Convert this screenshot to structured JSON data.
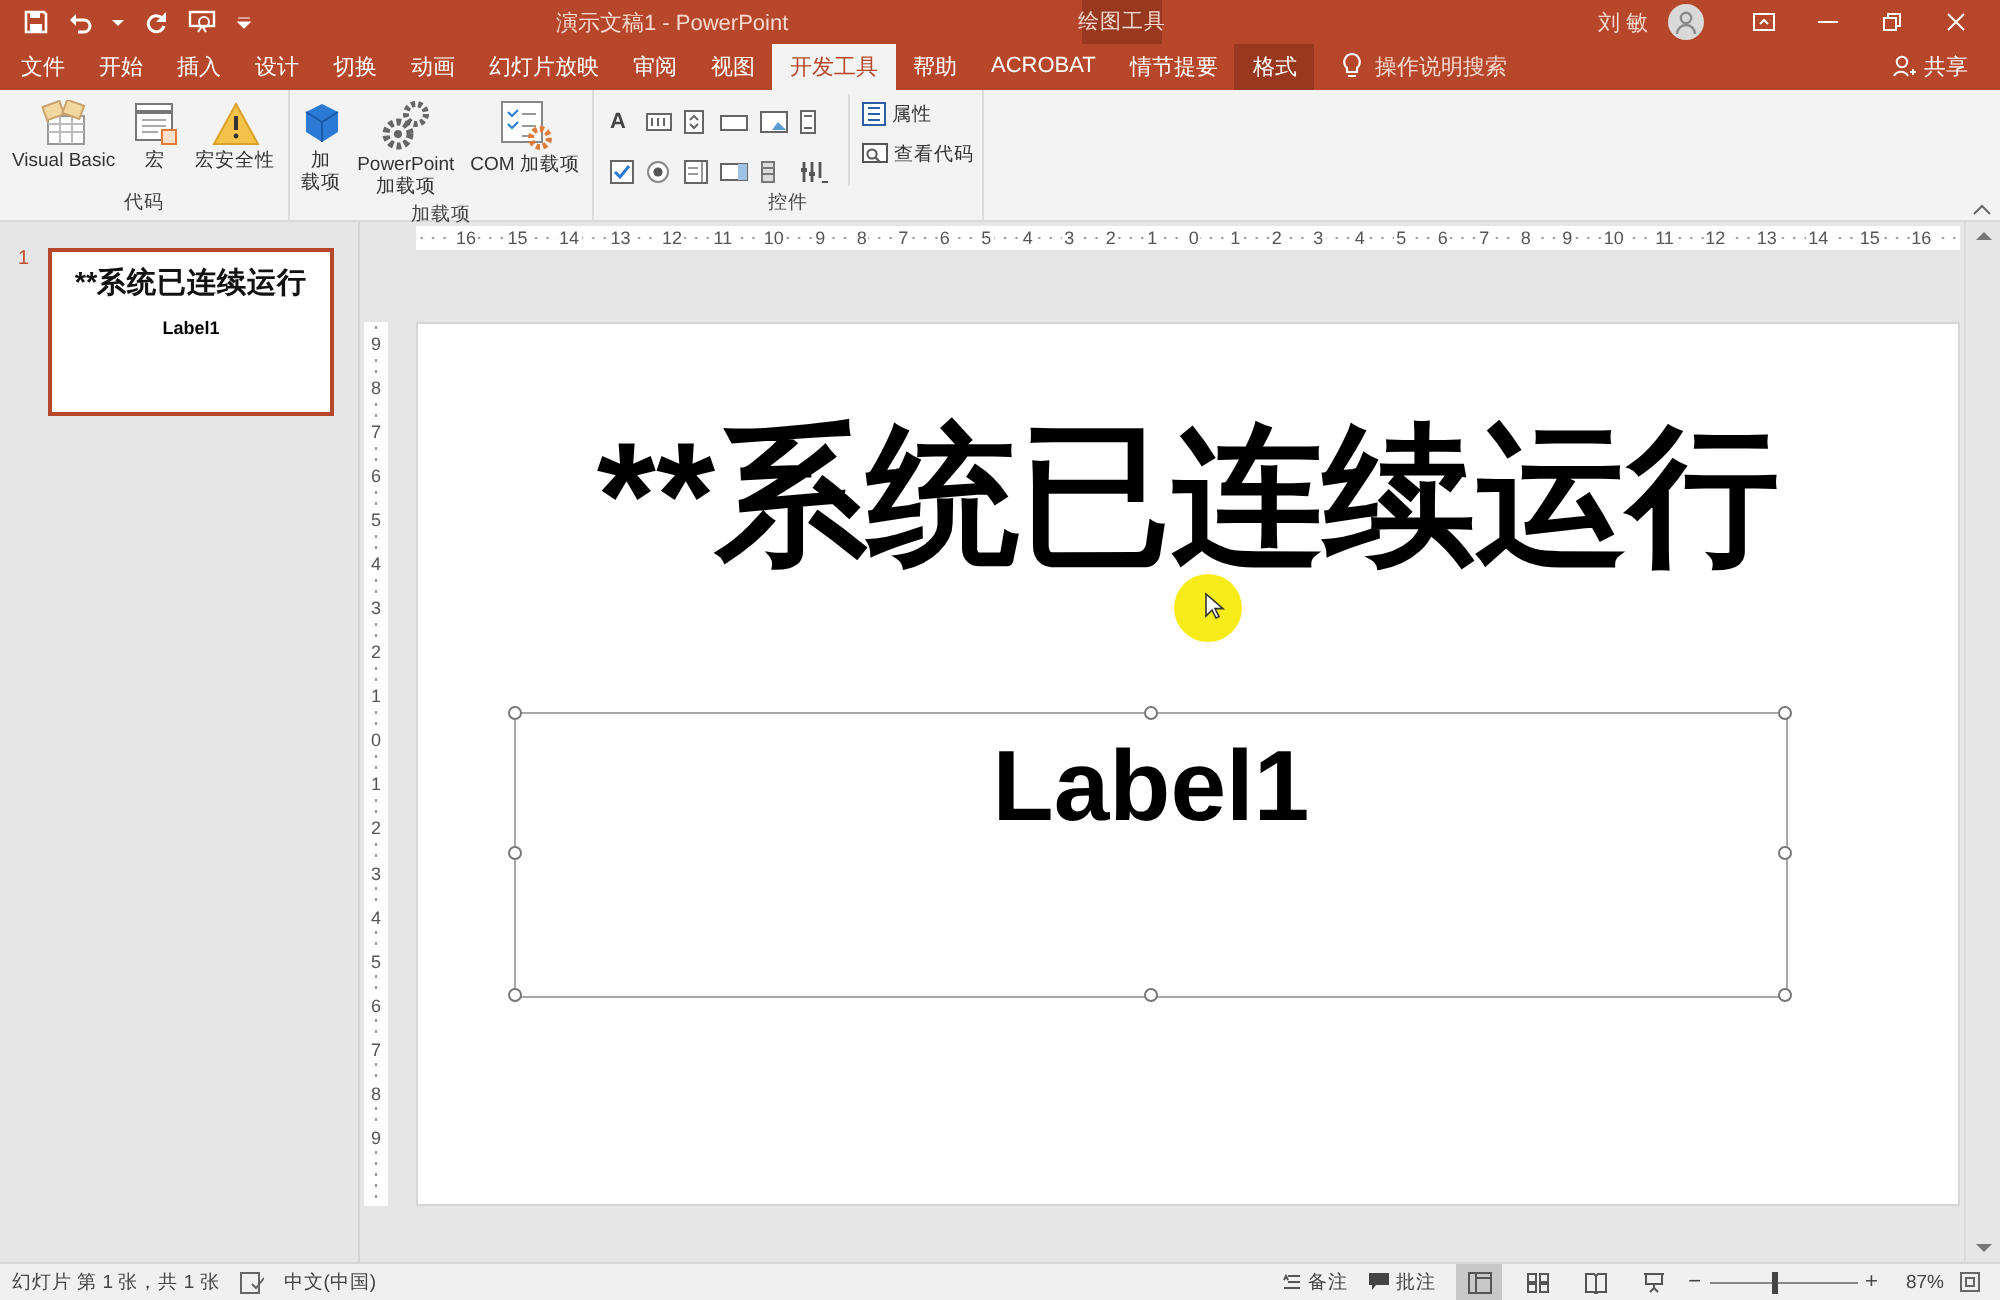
{
  "window": {
    "title": "演示文稿1 - PowerPoint",
    "context_header": "绘图工具",
    "user": "刘 敏"
  },
  "quick_access": [
    {
      "kind": "save"
    },
    {
      "kind": "undo"
    },
    {
      "kind": "dropdown"
    },
    {
      "kind": "redo"
    },
    {
      "kind": "start"
    },
    {
      "kind": "customize"
    }
  ],
  "tabs": [
    {
      "label": "文件",
      "selected": false,
      "kind": "normal"
    },
    {
      "label": "开始",
      "selected": false,
      "kind": "normal"
    },
    {
      "label": "插入",
      "selected": false,
      "kind": "normal"
    },
    {
      "label": "设计",
      "selected": false,
      "kind": "normal"
    },
    {
      "label": "切换",
      "selected": false,
      "kind": "normal"
    },
    {
      "label": "动画",
      "selected": false,
      "kind": "normal"
    },
    {
      "label": "幻灯片放映",
      "selected": false,
      "kind": "normal"
    },
    {
      "label": "审阅",
      "selected": false,
      "kind": "normal"
    },
    {
      "label": "视图",
      "selected": false,
      "kind": "normal"
    },
    {
      "label": "开发工具",
      "selected": true,
      "kind": "normal"
    },
    {
      "label": "帮助",
      "selected": false,
      "kind": "normal"
    },
    {
      "label": "ACROBAT",
      "selected": false,
      "kind": "normal"
    },
    {
      "label": "情节提要",
      "selected": false,
      "kind": "normal"
    },
    {
      "label": "格式",
      "selected": false,
      "kind": "contextual"
    }
  ],
  "tell_me": "操作说明搜索",
  "share": "共享",
  "ribbon": {
    "groups": [
      {
        "label": "代码",
        "buttons": [
          {
            "kind": "vb",
            "lines": [
              "Visual Basic"
            ]
          },
          {
            "kind": "macro",
            "lines": [
              "宏"
            ]
          },
          {
            "kind": "security",
            "lines": [
              "宏安全性"
            ]
          }
        ]
      },
      {
        "label": "加载项",
        "buttons": [
          {
            "kind": "store",
            "lines": [
              "加",
              "载项"
            ]
          },
          {
            "kind": "gears",
            "lines": [
              "PowerPoint",
              "加载项"
            ]
          },
          {
            "kind": "com",
            "lines": [
              "COM 加载项"
            ]
          }
        ]
      },
      {
        "label": "控件",
        "tools": [
          {
            "kind": "label",
            "glyph": "A"
          },
          {
            "kind": "textbox"
          },
          {
            "kind": "spin"
          },
          {
            "kind": "command"
          },
          {
            "kind": "image"
          },
          {
            "kind": "scroll"
          },
          {
            "kind": "checkbox"
          },
          {
            "kind": "radio"
          },
          {
            "kind": "list"
          },
          {
            "kind": "combo"
          },
          {
            "kind": "toggle"
          },
          {
            "kind": "more"
          }
        ],
        "small_buttons": [
          {
            "kind": "properties",
            "label": "属性"
          },
          {
            "kind": "code",
            "label": "查看代码"
          }
        ]
      }
    ]
  },
  "thumbnails": [
    {
      "number": "1",
      "title": "**系统已连续运行",
      "body": "Label1",
      "selected": true
    }
  ],
  "rulers": {
    "horizontal": [
      "16",
      "15",
      "14",
      "13",
      "12",
      "11",
      "10",
      "9",
      "8",
      "7",
      "6",
      "5",
      "4",
      "3",
      "2",
      "1",
      "0",
      "1",
      "2",
      "3",
      "4",
      "5",
      "6",
      "7",
      "8",
      "9",
      "10",
      "11",
      "12",
      "13",
      "14",
      "15",
      "16"
    ],
    "vertical": [
      "9",
      "8",
      "7",
      "6",
      "5",
      "4",
      "3",
      "2",
      "1",
      "0",
      "1",
      "2",
      "3",
      "4",
      "5",
      "6",
      "7",
      "8",
      "9"
    ]
  },
  "slide": {
    "title": "**系统已连续运行",
    "label": {
      "text": "Label1",
      "selected": true
    }
  },
  "status_bar": {
    "slide_info": "幻灯片 第 1 张，共 1 张",
    "language": "中文(中国)",
    "notes": "备注",
    "comments": "批注",
    "views": [
      {
        "kind": "normal",
        "selected": true
      },
      {
        "kind": "sorter",
        "selected": false
      },
      {
        "kind": "reading",
        "selected": false
      },
      {
        "kind": "show",
        "selected": false
      }
    ],
    "zoom_minus": "−",
    "zoom_plus": "+",
    "zoom": {
      "level": 0.43
    },
    "zoom_text": "87%"
  }
}
